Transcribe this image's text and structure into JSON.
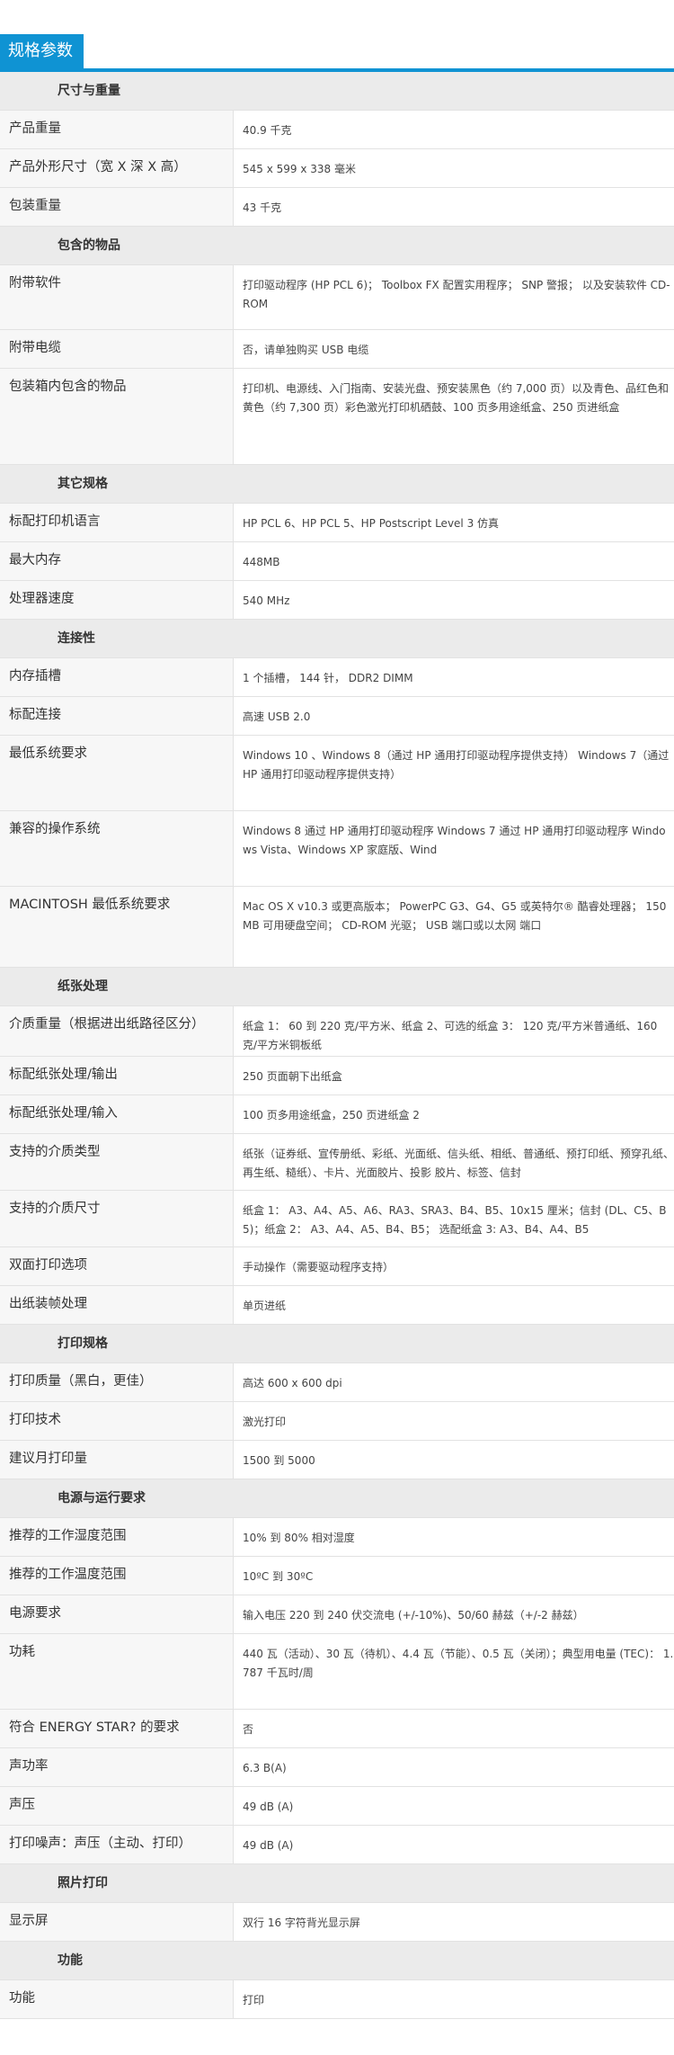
{
  "tab": {
    "label": "规格参数"
  },
  "sections": [
    {
      "title": "尺寸与重量",
      "rows": [
        {
          "label": "产品重量",
          "value": "40.9 千克"
        },
        {
          "label": "产品外形尺寸（宽 X 深 X 高）",
          "value": "545 x 599 x 338 毫米"
        },
        {
          "label": "包装重量",
          "value": "43 千克"
        }
      ]
    },
    {
      "title": "包含的物品",
      "rows": [
        {
          "label": "附带软件",
          "value": "打印驱动程序 (HP PCL 6)； Toolbox FX 配置实用程序； SNP 警报； 以及安装软件 CD-ROM"
        },
        {
          "label": "附带电缆",
          "value": "否，请单独购买 USB 电缆"
        },
        {
          "label": "包装箱内包含的物品",
          "value": "打印机、电源线、入门指南、安装光盘、预安装黑色（约 7,000 页）以及青色、品红色和黄色（约 7,300 页）彩色激光打印机硒鼓、100 页多用途纸盒、250 页进纸盒"
        }
      ]
    },
    {
      "title": "其它规格",
      "rows": [
        {
          "label": "标配打印机语言",
          "value": "HP PCL 6、HP PCL 5、HP Postscript Level 3 仿真"
        },
        {
          "label": "最大内存",
          "value": "448MB"
        },
        {
          "label": "处理器速度",
          "value": "540 MHz"
        }
      ]
    },
    {
      "title": "连接性",
      "rows": [
        {
          "label": "内存插槽",
          "value": "1 个插槽， 144 针， DDR2 DIMM"
        },
        {
          "label": "标配连接",
          "value": "高速 USB 2.0"
        },
        {
          "label": "最低系统要求",
          "value": "Windows 10 、Windows 8（通过 HP 通用打印驱动程序提供支持） Windows 7（通过 HP 通用打印驱动程序提供支持）"
        },
        {
          "label": "兼容的操作系统",
          "value": "Windows 8 通过 HP 通用打印驱动程序 Windows 7 通过 HP 通用打印驱动程序 Windows Vista、Windows XP 家庭版、Wind"
        },
        {
          "label": "MACINTOSH 最低系统要求",
          "value": "Mac OS X v10.3 或更高版本； PowerPC G3、G4、G5 或英特尔® 酷睿处理器； 150MB 可用硬盘空间； CD-ROM 光驱； USB 端口或以太网 端口"
        }
      ]
    },
    {
      "title": "纸张处理",
      "rows": [
        {
          "label": "介质重量（根据进出纸路径区分）",
          "value": "纸盒 1： 60 到 220 克/平方米、纸盒 2、可选的纸盒 3： 120 克/平方米普通纸、160 克/平方米铜板纸"
        },
        {
          "label": "标配纸张处理/输出",
          "value": "250 页面朝下出纸盒"
        },
        {
          "label": "标配纸张处理/输入",
          "value": "100 页多用途纸盒，250 页进纸盒 2"
        },
        {
          "label": "支持的介质类型",
          "value": "纸张（证券纸、宣传册纸、彩纸、光面纸、信头纸、相纸、普通纸、预打印纸、预穿孔纸、再生纸、糙纸）、卡片、光面胶片、投影 胶片、标签、信封"
        },
        {
          "label": "支持的介质尺寸",
          "value": "纸盒 1： A3、A4、A5、A6、RA3、SRA3、B4、B5、10x15 厘米；信封 (DL、C5、B5)；纸盒 2： A3、A4、A5、B4、B5； 选配纸盒 3: A3、B4、A4、B5"
        },
        {
          "label": "双面打印选项",
          "value": "手动操作（需要驱动程序支持）"
        },
        {
          "label": "出纸装帧处理",
          "value": "单页进纸"
        }
      ]
    },
    {
      "title": "打印规格",
      "rows": [
        {
          "label": "打印质量（黑白，更佳）",
          "value": "高达 600 x 600 dpi"
        },
        {
          "label": "打印技术",
          "value": "激光打印"
        },
        {
          "label": "建议月打印量",
          "value": "1500 到 5000"
        }
      ]
    },
    {
      "title": "电源与运行要求",
      "rows": [
        {
          "label": "推荐的工作湿度范围",
          "value": "10% 到 80% 相对湿度"
        },
        {
          "label": "推荐的工作温度范围",
          "value": "10ºC 到 30ºC"
        },
        {
          "label": "电源要求",
          "value": "输入电压 220 到 240 伏交流电 (+/-10%)、50/60 赫兹（+/-2 赫兹）"
        },
        {
          "label": "功耗",
          "value": "440 瓦（活动）、30 瓦（待机）、4.4 瓦（节能）、0.5 瓦（关闭）；典型用电量 (TEC)： 1.787 千瓦时/周"
        },
        {
          "label": "符合 ENERGY STAR? 的要求",
          "value": "否"
        },
        {
          "label": "声功率",
          "value": "6.3 B(A)"
        },
        {
          "label": "声压",
          "value": "49 dB (A)"
        },
        {
          "label": "打印噪声：声压（主动、打印）",
          "value": "49 dB (A)"
        }
      ]
    },
    {
      "title": "照片打印",
      "rows": [
        {
          "label": "显示屏",
          "value": "双行 16 字符背光显示屏"
        }
      ]
    },
    {
      "title": "功能",
      "rows": [
        {
          "label": "功能",
          "value": "打印"
        }
      ]
    }
  ]
}
